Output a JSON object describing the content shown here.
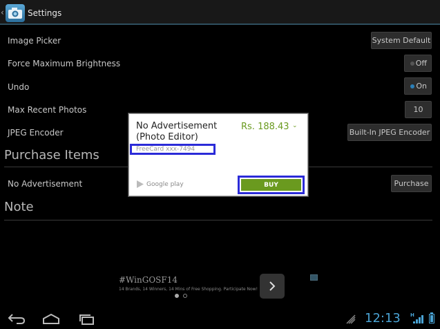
{
  "actionbar": {
    "title": "Settings"
  },
  "settings": {
    "image_picker": {
      "label": "Image Picker",
      "value": "System Default"
    },
    "brightness": {
      "label": "Force Maximum Brightness",
      "value": "Off"
    },
    "undo": {
      "label": "Undo",
      "value": "On"
    },
    "max_recent": {
      "label": "Max Recent Photos",
      "value": "10"
    },
    "jpeg": {
      "label": "JPEG Encoder",
      "value": "Built-In JPEG Encoder"
    }
  },
  "purchase": {
    "section_title": "Purchase Items",
    "item_label": "No Advertisement",
    "button_label": "Purchase"
  },
  "note": {
    "section_title": "Note"
  },
  "dialog": {
    "title": "No Advertisement (Photo Editor)",
    "price": "Rs. 188.43",
    "card": "FreeCard xxx-7494",
    "store": "Google play",
    "buy_label": "BUY"
  },
  "ad": {
    "title": "#WinGOSF14",
    "subtitle": "14 Brands, 14 Winners, 14 Mins of Free Shopping. Participate Now!"
  },
  "statusbar": {
    "time": "12:13"
  },
  "colors": {
    "accent": "#4aa3d4",
    "buy_green": "#6a9a1f",
    "highlight": "#2b2bd8"
  }
}
